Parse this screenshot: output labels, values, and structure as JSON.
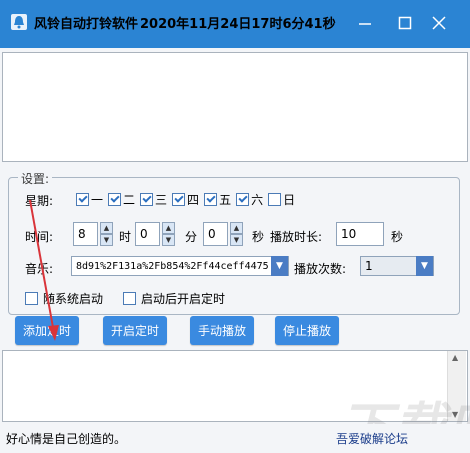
{
  "window": {
    "title": "风铃自动打铃软件",
    "datetime": "2020年11月24日17时6分41秒"
  },
  "settings": {
    "group_label": "设置:",
    "weekday_label": "星期:",
    "days": [
      {
        "label": "一",
        "checked": true
      },
      {
        "label": "二",
        "checked": true
      },
      {
        "label": "三",
        "checked": true
      },
      {
        "label": "四",
        "checked": true
      },
      {
        "label": "五",
        "checked": true
      },
      {
        "label": "六",
        "checked": true
      },
      {
        "label": "日",
        "checked": false
      }
    ],
    "time_label": "时间:",
    "hour_value": "8",
    "hour_unit": "时",
    "minute_value": "0",
    "minute_unit": "分",
    "second_value": "0",
    "second_unit": "秒",
    "duration_label": "播放时长:",
    "duration_value": "10",
    "duration_unit": "秒",
    "music_label": "音乐:",
    "music_value": "8d91%2F131a%2Fb854%2Ff44ceff4475",
    "play_count_label": "播放次数:",
    "play_count_value": "1",
    "startup_label": "随系统启动",
    "startup_checked": false,
    "auto_timer_label": "启动后开启定时",
    "auto_timer_checked": false
  },
  "buttons": {
    "add": "添加定时",
    "start": "开启定时",
    "manual": "手动播放",
    "stop": "停止播放"
  },
  "status": {
    "left_text": "好心情是自己创造的。",
    "right_text": "吾爱破解论坛"
  },
  "watermark": "下载吧",
  "colors": {
    "titlebar": "#2b84d3",
    "button": "#3a8ae0",
    "annotation_arrow": "#d9343a",
    "link": "#1a3c8a"
  }
}
